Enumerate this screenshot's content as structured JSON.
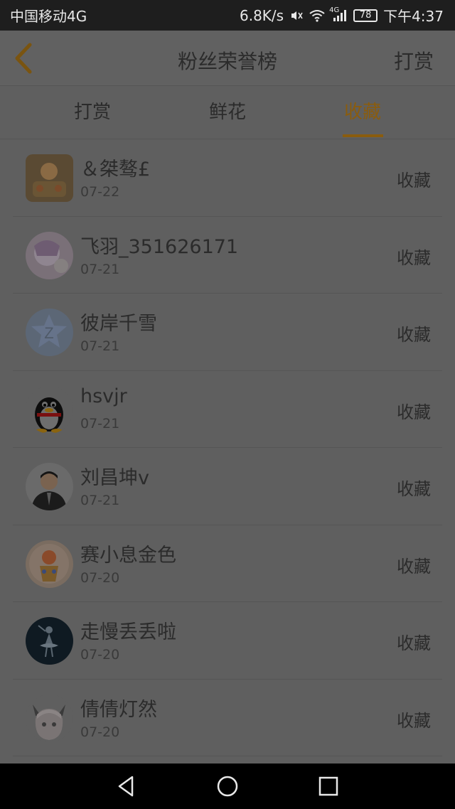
{
  "status_bar": {
    "carrier": "中国移动4G",
    "speed": "6.8K/s",
    "network": "4G",
    "battery": "78",
    "time": "下午4:37"
  },
  "header": {
    "title": "粉丝荣誉榜",
    "action": "打赏"
  },
  "tabs": [
    {
      "label": "打赏",
      "active": false
    },
    {
      "label": "鲜花",
      "active": false
    },
    {
      "label": "收藏",
      "active": true
    }
  ],
  "list": [
    {
      "name": "＆桀骜£",
      "date": "07-22",
      "action": "收藏"
    },
    {
      "name": "飞羽_351626171",
      "date": "07-21",
      "action": "收藏"
    },
    {
      "name": "彼岸千雪",
      "date": "07-21",
      "action": "收藏"
    },
    {
      "name": "hsvjr",
      "date": "07-21",
      "action": "收藏"
    },
    {
      "name": "刘昌坤v",
      "date": "07-21",
      "action": "收藏"
    },
    {
      "name": "赛小息金色",
      "date": "07-20",
      "action": "收藏"
    },
    {
      "name": "走慢丢丢啦",
      "date": "07-20",
      "action": "收藏"
    },
    {
      "name": "倩倩灯然",
      "date": "07-20",
      "action": "收藏"
    }
  ],
  "colors": {
    "accent": "#8a5c0e",
    "overlay_bg": "#5f5f5f",
    "status_bar_bg": "#1e1e1e"
  }
}
